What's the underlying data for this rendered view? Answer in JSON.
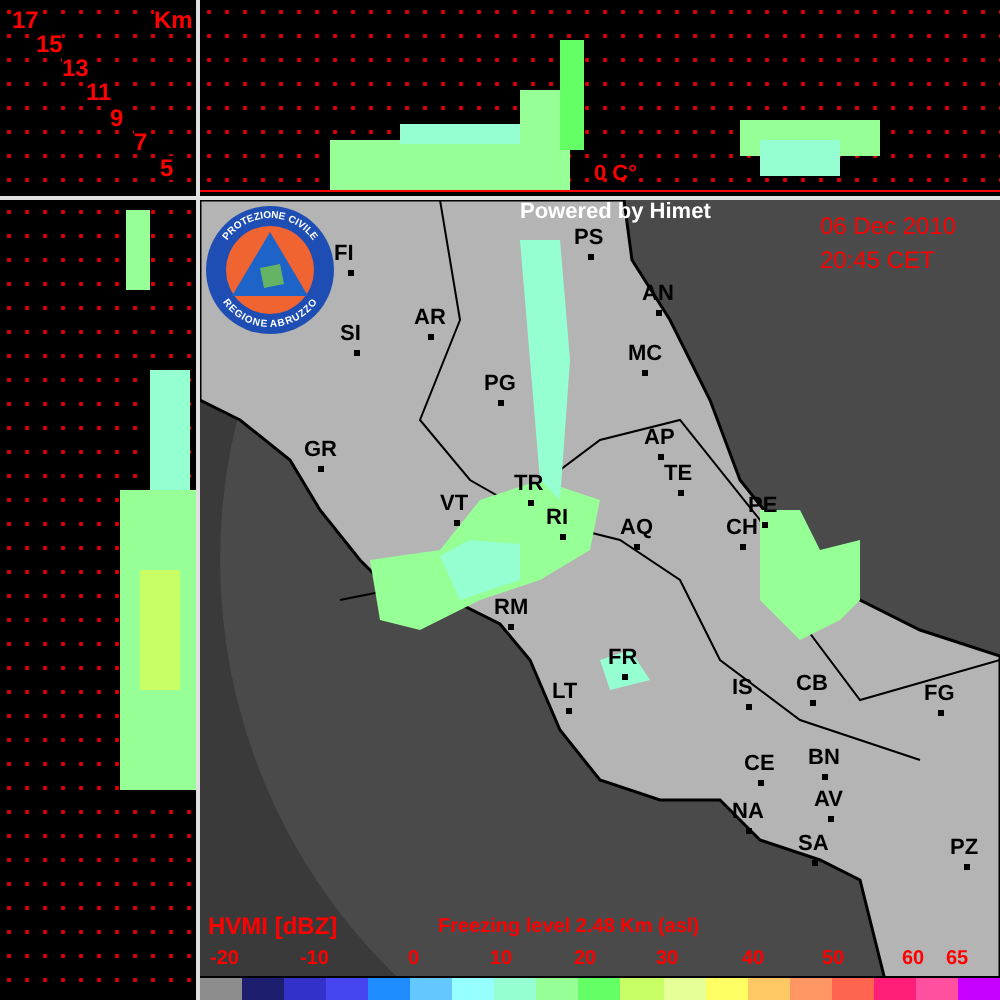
{
  "height_axis": {
    "unit": "Km",
    "ticks": [
      "17",
      "15",
      "13",
      "11",
      "9",
      "7",
      "5"
    ]
  },
  "cross_section": {
    "freezing_label": "0 C°"
  },
  "map": {
    "credit": "Powered by Himet",
    "date": "06 Dec 2010",
    "time": "20:45 CET",
    "logo": {
      "top_text": "PROTEZIONE CIVILE",
      "bottom_text": "REGIONE ABRUZZO"
    },
    "cities": [
      {
        "label": "FI"
      },
      {
        "label": "PS"
      },
      {
        "label": "AR"
      },
      {
        "label": "SI"
      },
      {
        "label": "AN"
      },
      {
        "label": "MC"
      },
      {
        "label": "PG"
      },
      {
        "label": "AP"
      },
      {
        "label": "GR"
      },
      {
        "label": "TE"
      },
      {
        "label": "TR"
      },
      {
        "label": "VT"
      },
      {
        "label": "RI"
      },
      {
        "label": "PE"
      },
      {
        "label": "AQ"
      },
      {
        "label": "CH"
      },
      {
        "label": "RM"
      },
      {
        "label": "FR"
      },
      {
        "label": "IS"
      },
      {
        "label": "CB"
      },
      {
        "label": "LT"
      },
      {
        "label": "FG"
      },
      {
        "label": "BN"
      },
      {
        "label": "CE"
      },
      {
        "label": "AV"
      },
      {
        "label": "NA"
      },
      {
        "label": "SA"
      },
      {
        "label": "PZ"
      }
    ]
  },
  "legend": {
    "title": "HVMI [dBZ]",
    "freezing_level": "Freezing level 2.48 Km (asl)",
    "scale_labels": [
      "-20",
      "-10",
      "0",
      "10",
      "20",
      "30",
      "40",
      "50",
      "60",
      "65"
    ],
    "bins": [
      {
        "color": "#8c8c8c"
      },
      {
        "color": "#1e1e6e"
      },
      {
        "color": "#3232c8"
      },
      {
        "color": "#4646f0"
      },
      {
        "color": "#1e8cff"
      },
      {
        "color": "#64c8ff"
      },
      {
        "color": "#96ffff"
      },
      {
        "color": "#96ffd2"
      },
      {
        "color": "#96ff96"
      },
      {
        "color": "#64ff64"
      },
      {
        "color": "#c8ff64"
      },
      {
        "color": "#e6ff96"
      },
      {
        "color": "#ffff64"
      },
      {
        "color": "#ffc864"
      },
      {
        "color": "#ff9664"
      },
      {
        "color": "#ff6450"
      },
      {
        "color": "#ff1e78"
      },
      {
        "color": "#ff50a0"
      },
      {
        "color": "#c800ff"
      }
    ]
  }
}
